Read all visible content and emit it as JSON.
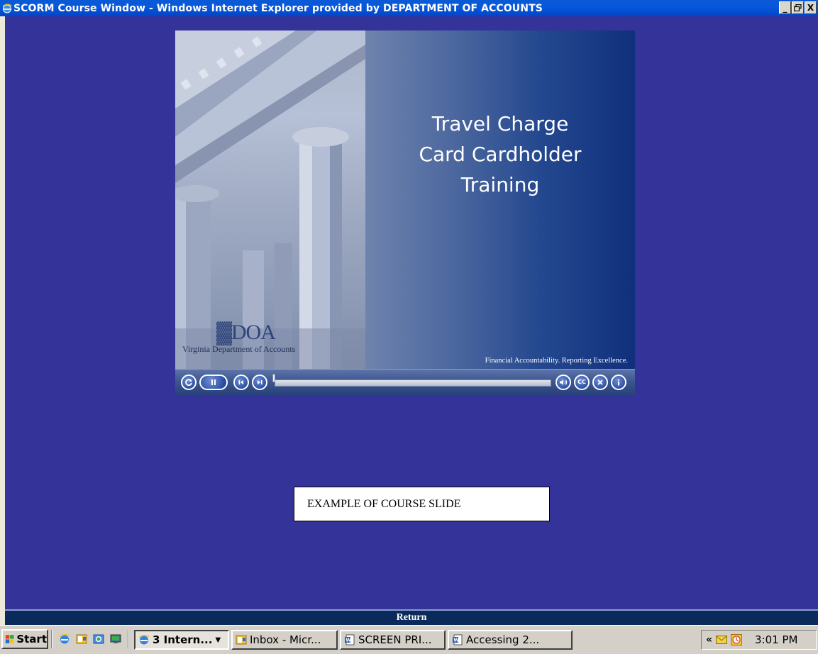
{
  "window": {
    "title": "SCORM Course Window - Windows Internet Explorer provided by DEPARTMENT OF ACCOUNTS",
    "controls": [
      "_",
      " ̅",
      "X"
    ]
  },
  "slide": {
    "title": "Travel Charge\nCard Cardholder\nTraining",
    "logo_mark": "▓DOA",
    "logo_text": "Virginia Department of Accounts",
    "tagline": "Financial Accountability. Reporting Excellence."
  },
  "player": {
    "progress": 0.0,
    "buttons": [
      "replay-icon",
      "pause-icon",
      "previous-icon",
      "next-icon",
      "volume-icon",
      "closed-captions-icon",
      "exit-icon",
      "info-icon"
    ],
    "cc_label": "CC"
  },
  "example_label": "EXAMPLE OF COURSE SLIDE",
  "return_label": "Return",
  "taskbar": {
    "start_label": "Start",
    "buttons": [
      {
        "label": "3 Intern...",
        "icon": "ie-icon"
      },
      {
        "label": "Inbox - Micr...",
        "icon": "outlook-icon"
      },
      {
        "label": "SCREEN PRI...",
        "icon": "word-icon"
      },
      {
        "label": "Accessing 2...",
        "icon": "word-icon"
      }
    ],
    "clock": "3:01 PM"
  },
  "colors": {
    "background": "#333399",
    "titlebar": "#0758dc",
    "return_bar": "#0b2a5c"
  }
}
